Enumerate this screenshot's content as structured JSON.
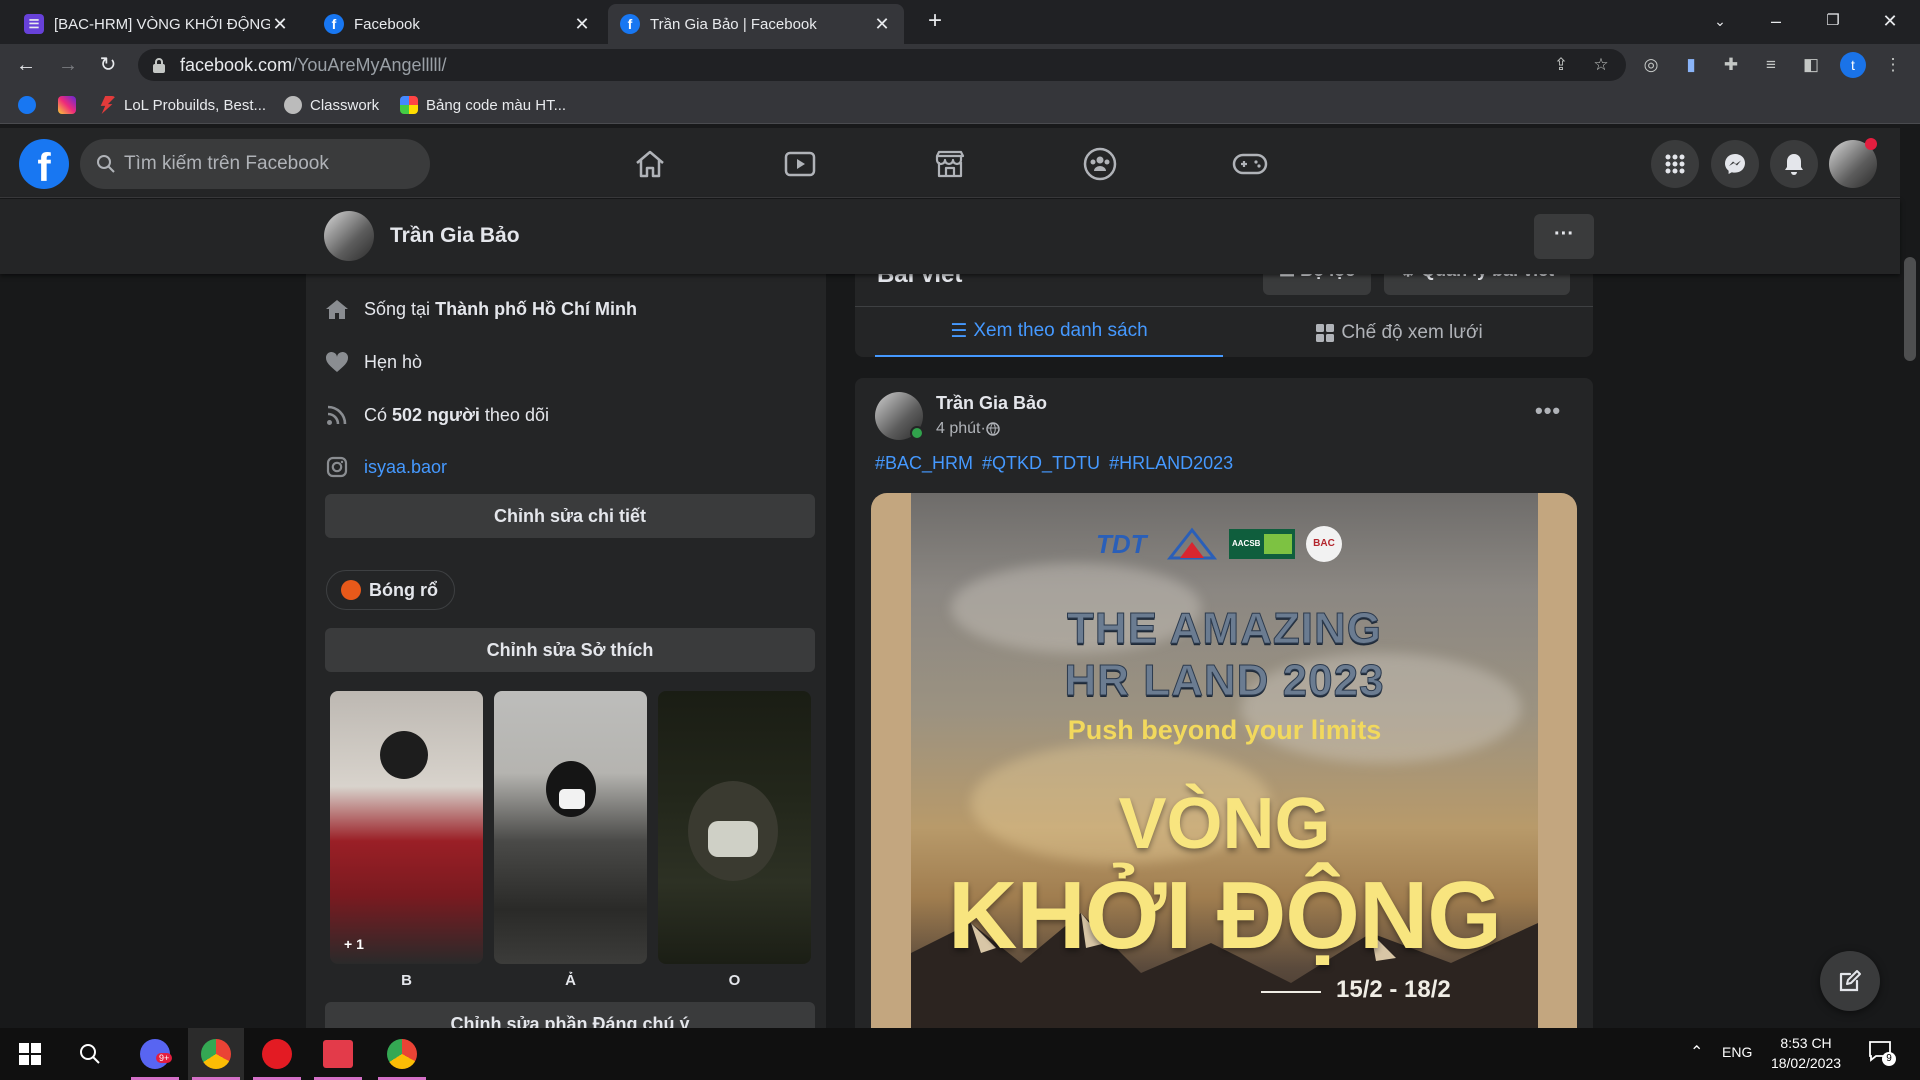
{
  "browser": {
    "tabs": [
      {
        "title": "[BAC-HRM] VÒNG KHỞI ĐỘNG C",
        "active": false
      },
      {
        "title": "Facebook",
        "active": false
      },
      {
        "title": "Trần Gia Bảo | Facebook",
        "active": true
      }
    ],
    "url_host": "facebook.com",
    "url_path": "/YouAreMyAngelllll/",
    "profile_initial": "t",
    "bookmarks": [
      {
        "label": "LoL Probuilds, Best..."
      },
      {
        "label": "Classwork"
      },
      {
        "label": "Bảng code màu HT..."
      }
    ]
  },
  "fb": {
    "search_placeholder": "Tìm kiếm trên Facebook",
    "brand_color": "#1877f2",
    "profile_name": "Trần Gia Bảo",
    "more_label": "···",
    "intro": {
      "lives_prefix": "Sống tại ",
      "lives_city": "Thành phố Hồ Chí Minh",
      "relationship": "Hẹn hò",
      "followers_prefix": "Có ",
      "followers_count": "502 người",
      "followers_suffix": " theo dõi",
      "instagram": "isyaa.baor",
      "edit_details": "Chỉnh sửa chi tiết",
      "hobby": "Bóng rổ",
      "edit_hobbies": "Chỉnh sửa Sở thích",
      "featured": [
        {
          "label": "B",
          "badge": "+ 1"
        },
        {
          "label": "Ả"
        },
        {
          "label": "O"
        }
      ],
      "edit_featured": "Chỉnh sửa phần Đáng chú ý"
    },
    "posts_header": {
      "title": "Bài viết",
      "filter": "Bộ lọc",
      "manage": "Quản lý bài viết",
      "tab_list": "Xem theo danh sách",
      "tab_grid": "Chế độ xem lưới"
    },
    "post": {
      "author": "Trần Gia Bảo",
      "time": "4 phút",
      "meta_sep": " · ",
      "hashtags": [
        "#BAC_HRM",
        "#QTKD_TDTU",
        "#HRLAND2023"
      ],
      "poster": {
        "title_line1": "THE AMAZING",
        "title_line2": "HR LAND 2023",
        "slogan": "Push beyond your limits",
        "headline1": "VÒNG",
        "headline2": "KHỞI ĐỘNG",
        "dates": "15/2 - 18/2",
        "logo1": "TDT",
        "logo3": "AACSB",
        "logo4": "BAC"
      }
    }
  },
  "taskbar": {
    "lang": "ENG",
    "time": "8:53 CH",
    "date": "18/02/2023",
    "notif_count": "9",
    "app_badge": "9+"
  }
}
